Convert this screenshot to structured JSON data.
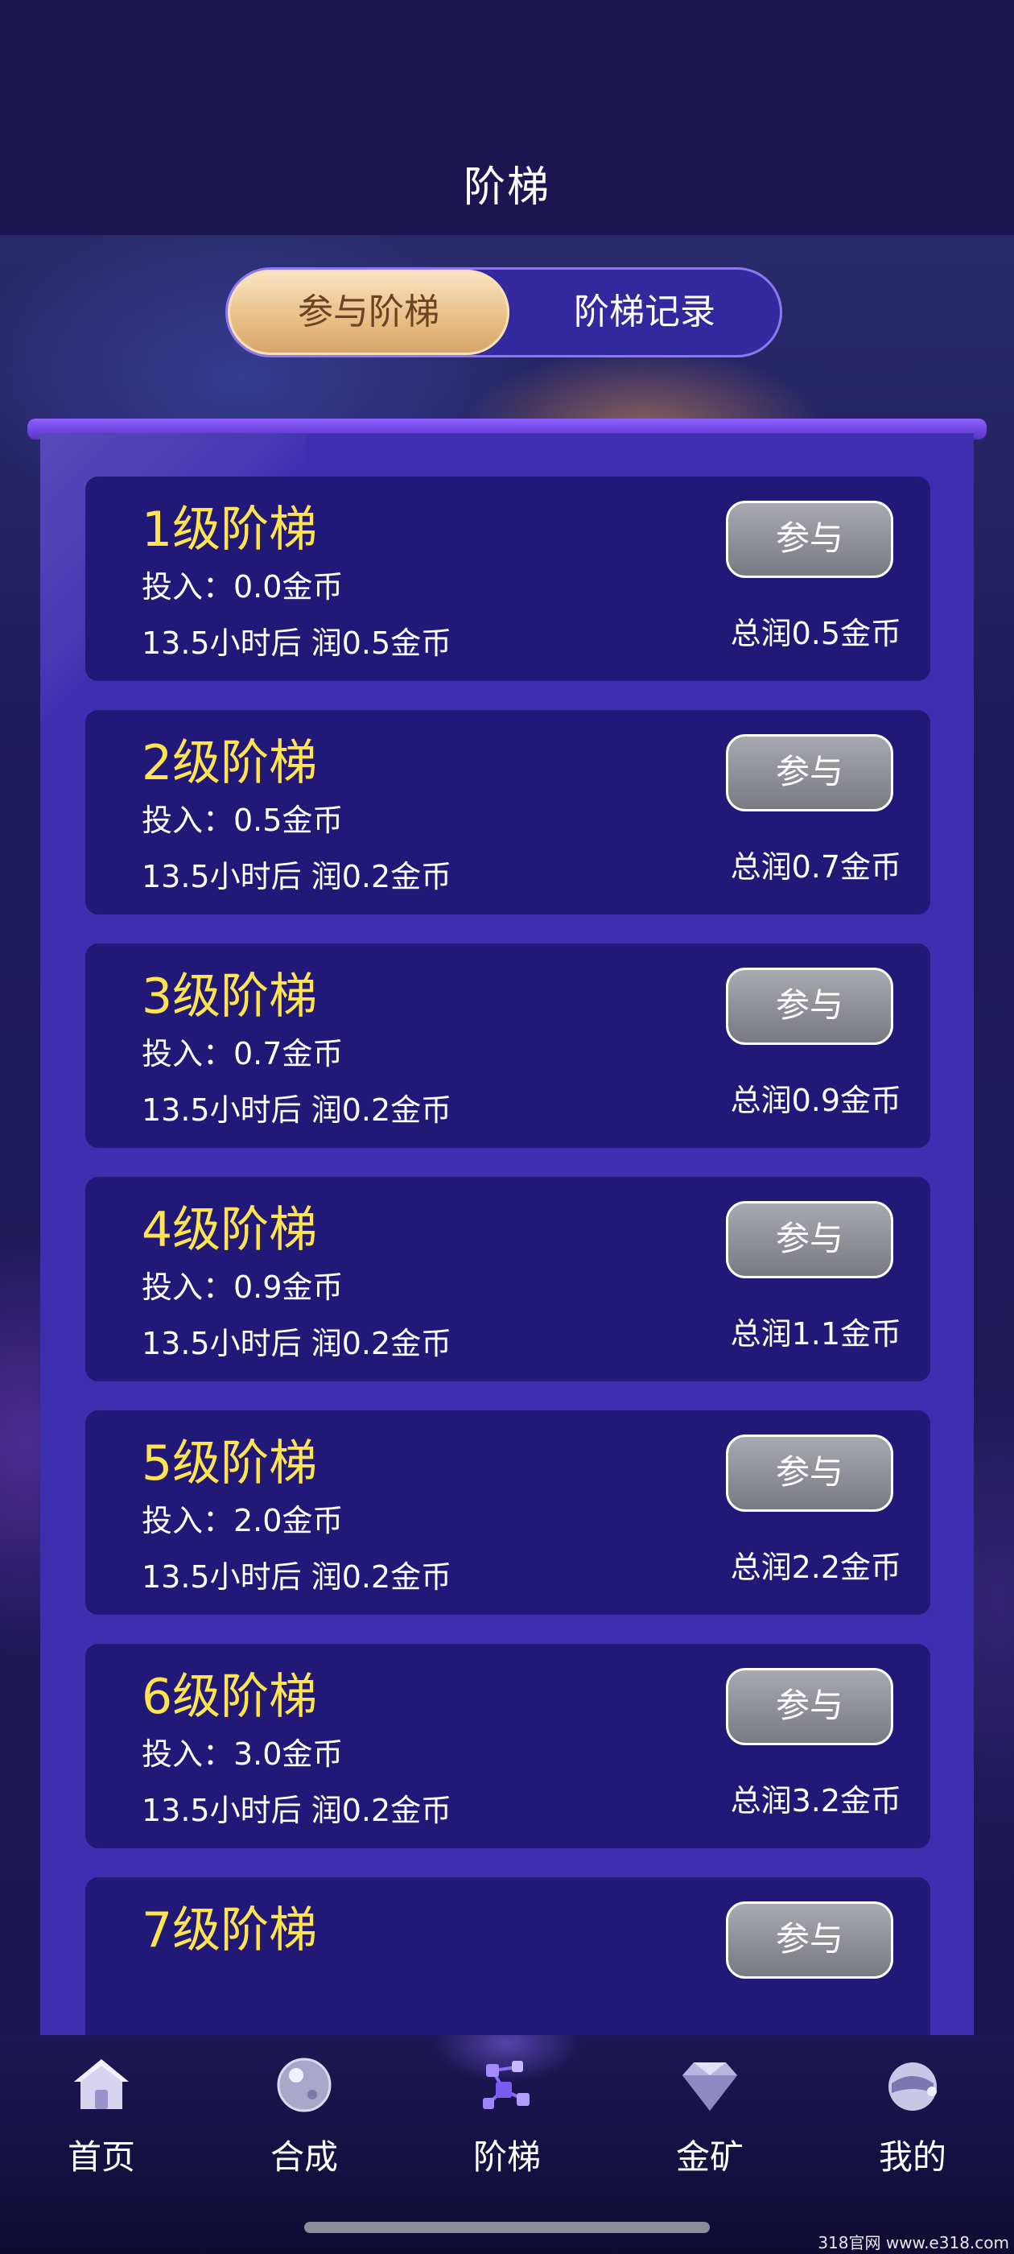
{
  "header": {
    "title": "阶梯"
  },
  "tabs": [
    {
      "label": "参与阶梯",
      "active": true
    },
    {
      "label": "阶梯记录",
      "active": false
    }
  ],
  "ladders": [
    {
      "title": "1级阶梯",
      "invest": "投入：0.0金币",
      "profit": "13.5小时后 润0.5金币",
      "total": "总润0.5金币",
      "button": "参与"
    },
    {
      "title": "2级阶梯",
      "invest": "投入：0.5金币",
      "profit": "13.5小时后 润0.2金币",
      "total": "总润0.7金币",
      "button": "参与"
    },
    {
      "title": "3级阶梯",
      "invest": "投入：0.7金币",
      "profit": "13.5小时后 润0.2金币",
      "total": "总润0.9金币",
      "button": "参与"
    },
    {
      "title": "4级阶梯",
      "invest": "投入：0.9金币",
      "profit": "13.5小时后 润0.2金币",
      "total": "总润1.1金币",
      "button": "参与"
    },
    {
      "title": "5级阶梯",
      "invest": "投入：2.0金币",
      "profit": "13.5小时后 润0.2金币",
      "total": "总润2.2金币",
      "button": "参与"
    },
    {
      "title": "6级阶梯",
      "invest": "投入：3.0金币",
      "profit": "13.5小时后 润0.2金币",
      "total": "总润3.2金币",
      "button": "参与"
    },
    {
      "title": "7级阶梯",
      "button": "参与"
    }
  ],
  "nav": [
    {
      "label": "首页",
      "icon": "home-icon"
    },
    {
      "label": "合成",
      "icon": "orb-icon"
    },
    {
      "label": "阶梯",
      "icon": "cubes-icon",
      "active": true
    },
    {
      "label": "金矿",
      "icon": "diamond-icon"
    },
    {
      "label": "我的",
      "icon": "helmet-icon"
    }
  ],
  "watermark": "318官网 www.e318.com",
  "colors": {
    "accent_gold": "#ffe44d",
    "panel": "#3f2fb0",
    "card": "#221878"
  }
}
